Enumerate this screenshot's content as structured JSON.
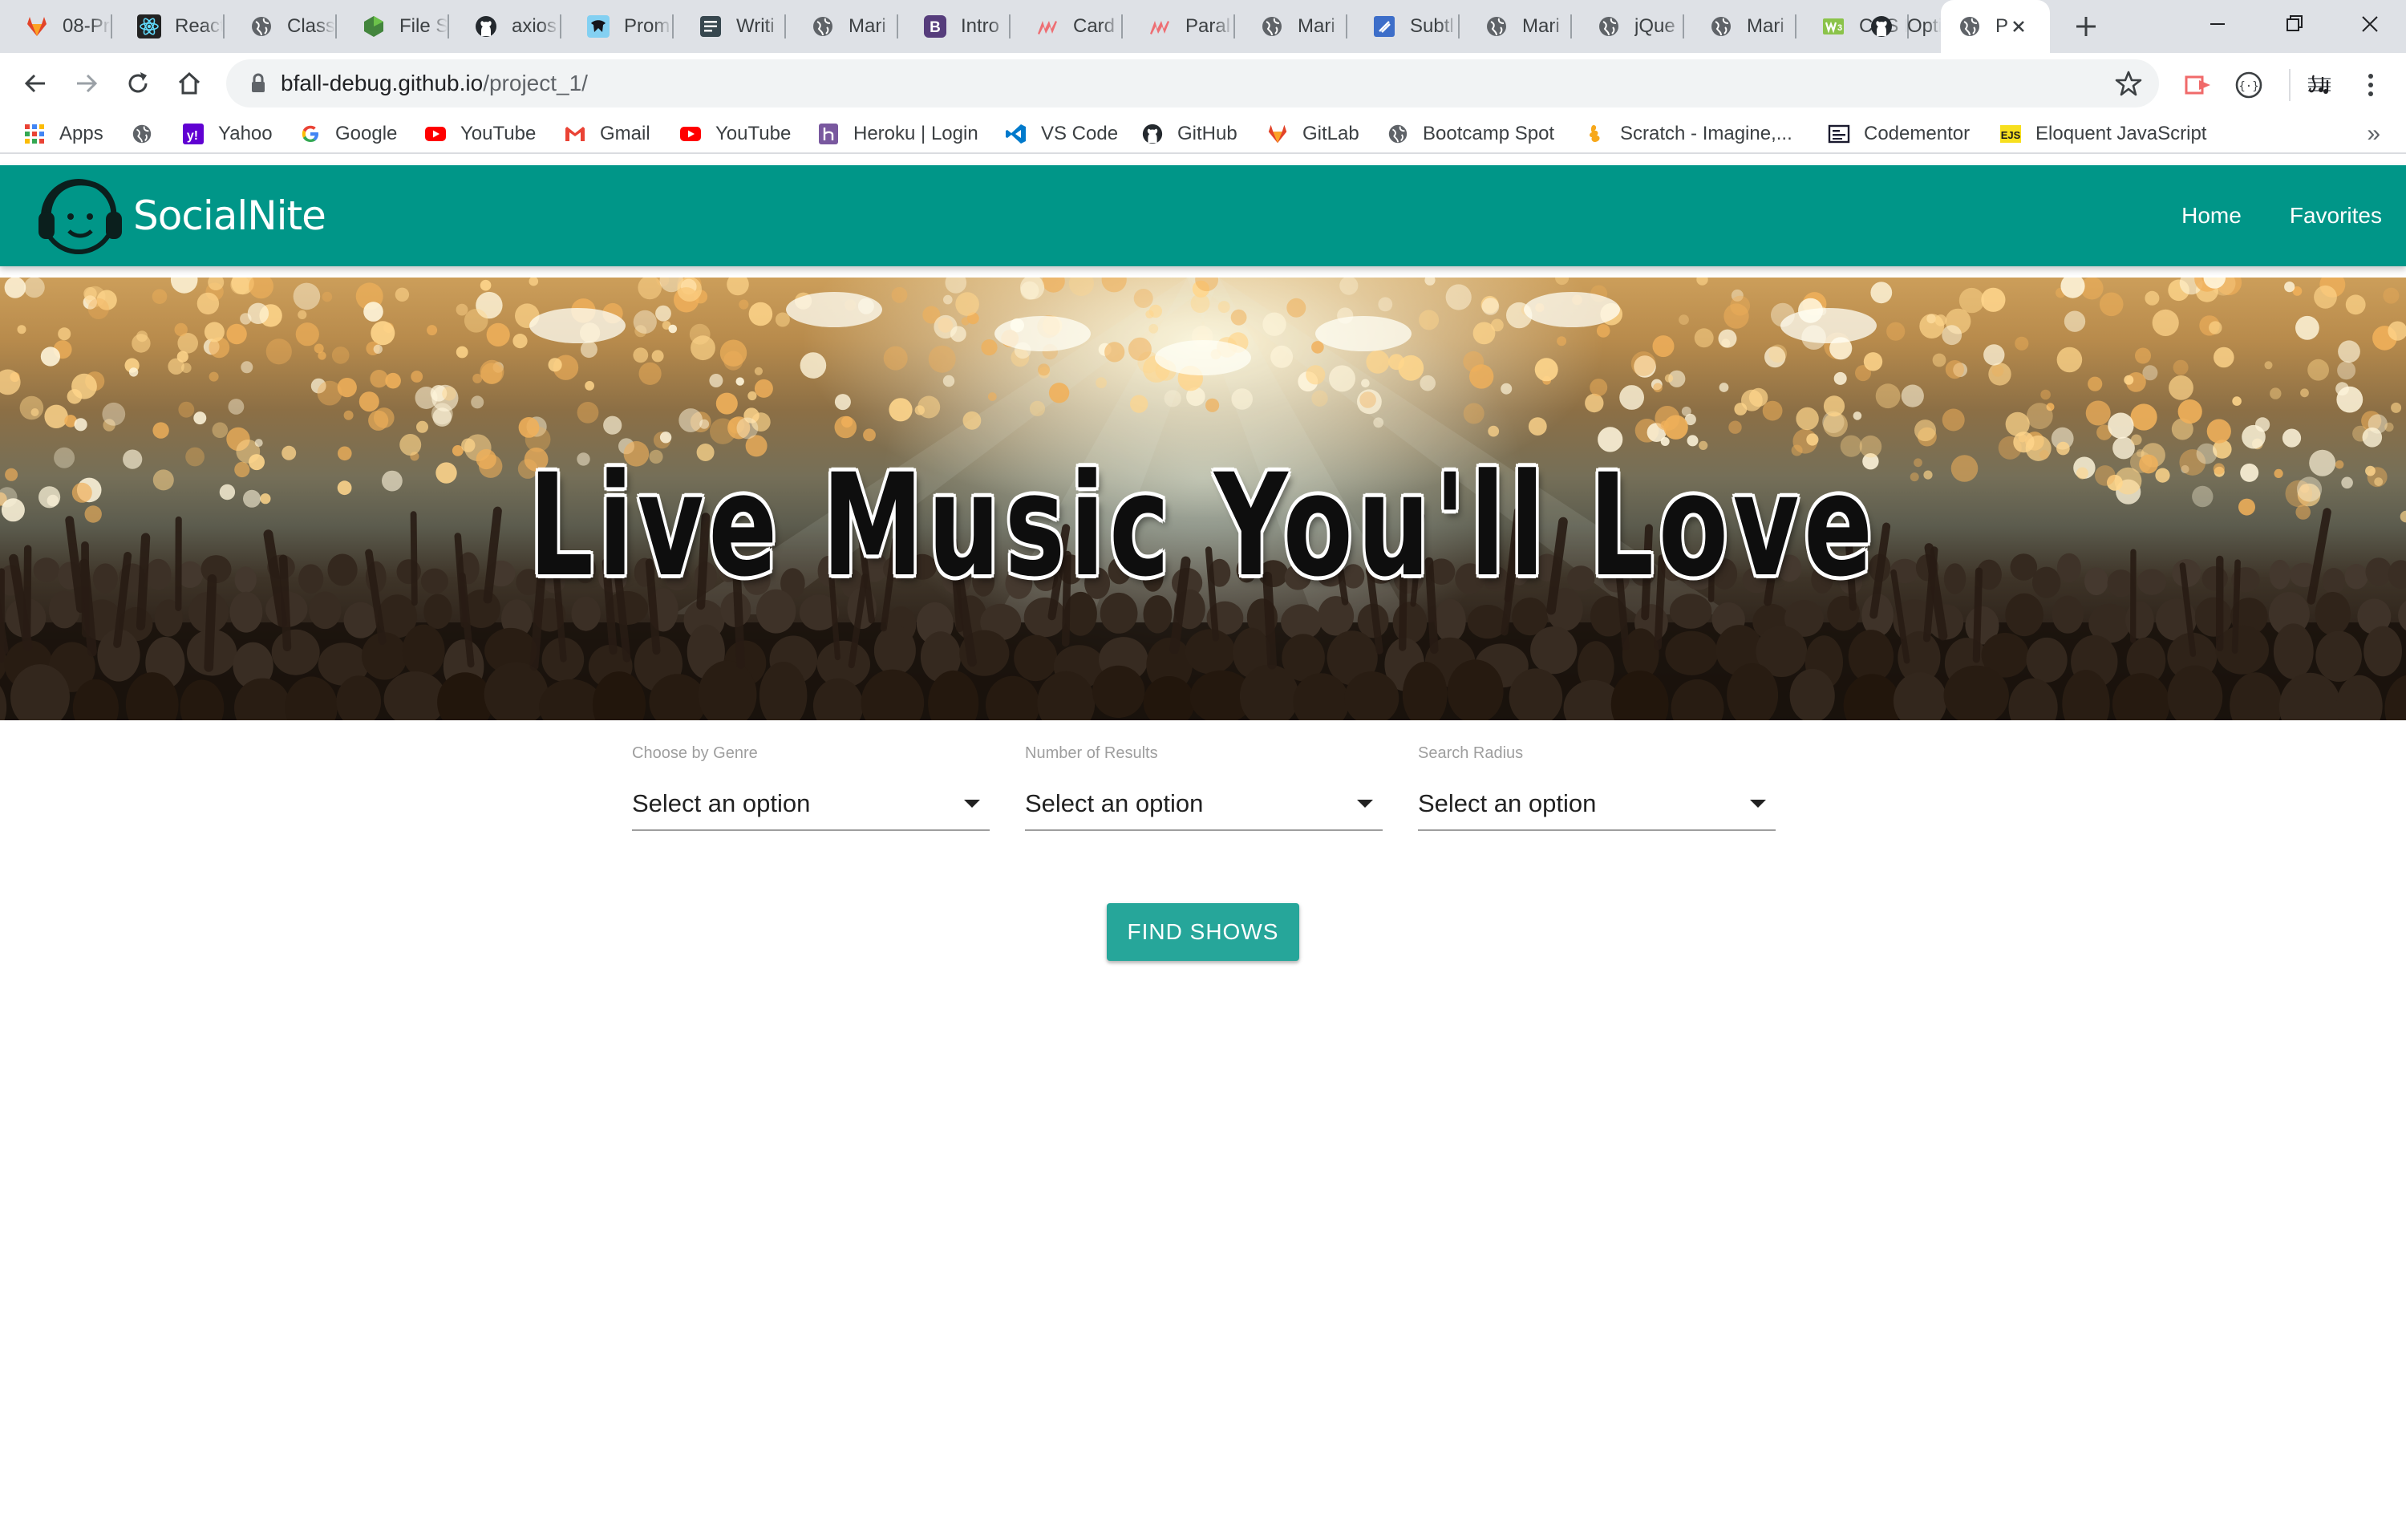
{
  "browser": {
    "tabs": [
      {
        "title": "08-Pr",
        "icon": "gitlab-icon",
        "color": "#e24329"
      },
      {
        "title": "React",
        "icon": "react-icon",
        "color": "#61dafb"
      },
      {
        "title": "Class",
        "icon": "globe-icon",
        "color": "#5f6368"
      },
      {
        "title": "File S",
        "icon": "nodejs-icon",
        "color": "#43853d"
      },
      {
        "title": "axios",
        "icon": "github-icon",
        "color": "#24292e"
      },
      {
        "title": "Prom",
        "icon": "mdn-icon",
        "color": "#4a90d9"
      },
      {
        "title": "Writi",
        "icon": "document-icon",
        "color": "#37474f"
      },
      {
        "title": "Mari",
        "icon": "globe-icon",
        "color": "#5f6368"
      },
      {
        "title": "Intro",
        "icon": "bootstrap-icon",
        "color": "#563d7c"
      },
      {
        "title": "Card",
        "icon": "materialize-icon",
        "color": "#ee6e73"
      },
      {
        "title": "Paral",
        "icon": "materialize-icon",
        "color": "#ee6e73"
      },
      {
        "title": "Mari",
        "icon": "globe-icon",
        "color": "#5f6368"
      },
      {
        "title": "Subtl",
        "icon": "stackoverflow-icon",
        "color": "#3d6ec9"
      },
      {
        "title": "Mari",
        "icon": "globe-icon",
        "color": "#5f6368"
      },
      {
        "title": "jQue",
        "icon": "globe-icon",
        "color": "#5f6368"
      },
      {
        "title": "Mari",
        "icon": "globe-icon",
        "color": "#5f6368"
      },
      {
        "title": "CSS F",
        "icon": "w3c-icon",
        "color": "#8bc34a"
      },
      {
        "title": "Optic",
        "icon": "github-icon",
        "color": "#24292e"
      }
    ],
    "active_tab": {
      "title": "P",
      "icon": "globe-icon"
    },
    "url_host": "bfall-debug.github.io",
    "url_path": "/project_1/",
    "bookmarks": [
      {
        "label": "Apps",
        "icon": "apps-grid-icon"
      },
      {
        "label": "",
        "icon": "globe-icon"
      },
      {
        "label": "Yahoo",
        "icon": "yahoo-icon"
      },
      {
        "label": "Google",
        "icon": "google-icon"
      },
      {
        "label": "YouTube",
        "icon": "youtube-icon"
      },
      {
        "label": "Gmail",
        "icon": "gmail-icon"
      },
      {
        "label": "YouTube",
        "icon": "youtube-icon"
      },
      {
        "label": "Heroku | Login",
        "icon": "heroku-icon"
      },
      {
        "label": "VS Code",
        "icon": "vscode-icon"
      },
      {
        "label": "GitHub",
        "icon": "github-icon"
      },
      {
        "label": "GitLab",
        "icon": "gitlab-icon"
      },
      {
        "label": "Bootcamp Spot",
        "icon": "globe-icon"
      },
      {
        "label": "Scratch - Imagine,...",
        "icon": "scratch-icon"
      },
      {
        "label": "Codementor",
        "icon": "codementor-icon"
      },
      {
        "label": "Eloquent JavaScript",
        "icon": "ejs-icon"
      }
    ],
    "bookmarks_overflow": "»"
  },
  "site": {
    "brand": "SocialNite",
    "nav": [
      "Home",
      "Favorites"
    ],
    "hero_title": "Live Music You'll Love",
    "form": {
      "fields": [
        {
          "label": "Choose by Genre",
          "value": "Select an option"
        },
        {
          "label": "Number of Results",
          "value": "Select an option"
        },
        {
          "label": "Search Radius",
          "value": "Select an option"
        }
      ],
      "submit": "FIND SHOWS"
    }
  },
  "colors": {
    "navbar": "#009688",
    "button": "#26a69a",
    "tabstrip": "#dee1e6"
  }
}
